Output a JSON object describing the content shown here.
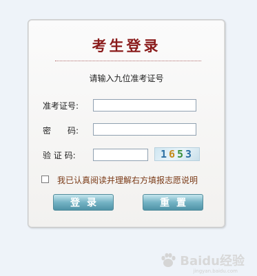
{
  "form": {
    "title": "考生登录",
    "instruction": "请输入九位准考证号",
    "fields": [
      {
        "label": "准考证号:",
        "value": "",
        "placeholder": ""
      },
      {
        "label": "密　　码:",
        "value": "",
        "placeholder": ""
      },
      {
        "label": "验 证 码:",
        "value": "",
        "placeholder": ""
      }
    ],
    "captcha_text": "1653",
    "agree_label": "我已认真阅读并理解右方填报志愿说明",
    "agree_checked": false,
    "login_button": "登录",
    "reset_button": "重置"
  },
  "watermark": {
    "brand": "Baidu经验",
    "sub": "jingyan.baidu.com"
  },
  "colors": {
    "title": "#8a1b1b",
    "button": "#74b3c4",
    "agree_text": "#7a3a16"
  }
}
